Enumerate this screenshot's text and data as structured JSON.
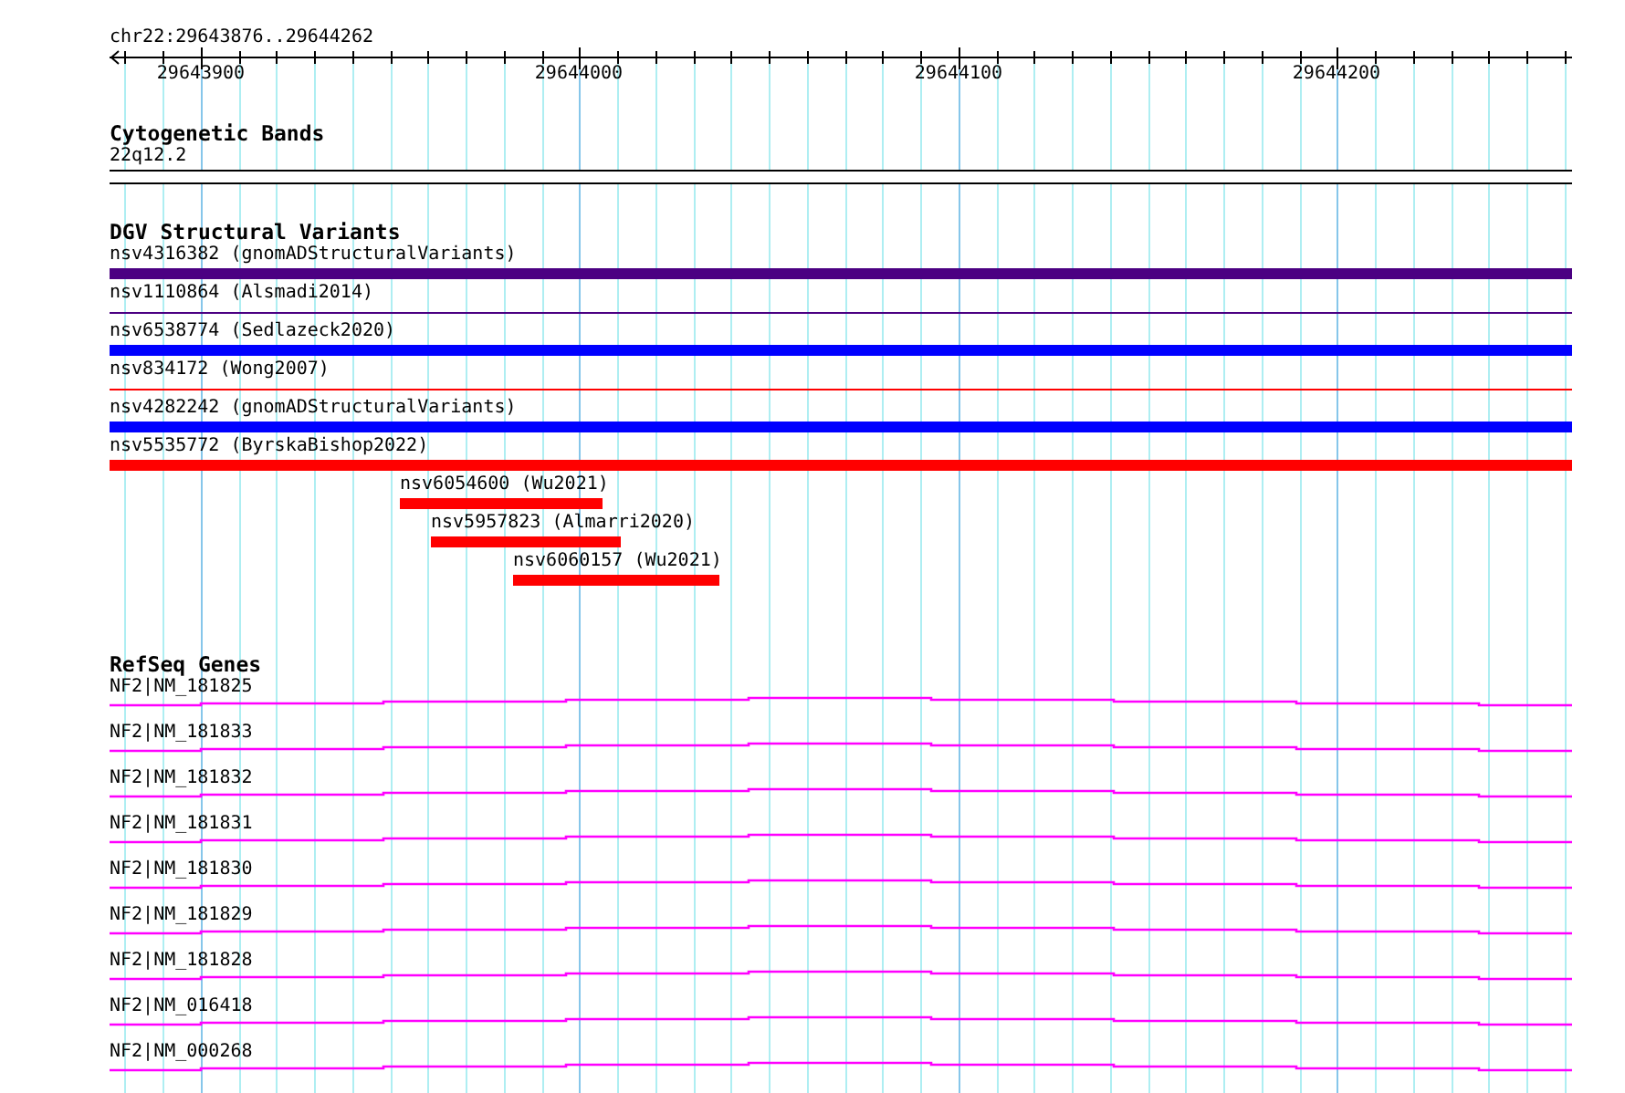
{
  "location": "chr22:29643876..29644262",
  "ruler": {
    "ticks": [
      "29643900",
      "29644000",
      "29644100",
      "29644200"
    ]
  },
  "tracks": [
    {
      "kind": "cytoband",
      "title": "Cytogenetic Bands",
      "band": "22q12.2"
    },
    {
      "kind": "variants",
      "title": "DGV Structural Variants",
      "features": [
        {
          "label": "nsv4316382 (gnomADStructuralVariants)",
          "kind": "bar",
          "color": "#4b0082"
        },
        {
          "label": "nsv1110864 (Alsmadi2014)",
          "kind": "line",
          "color": "#4b0082"
        },
        {
          "label": "nsv6538774 (Sedlazeck2020)",
          "kind": "bar",
          "color": "#0000ff"
        },
        {
          "label": "nsv834172 (Wong2007)",
          "kind": "line",
          "color": "#ff0000"
        },
        {
          "label": "nsv4282242 (gnomADStructuralVariants)",
          "kind": "bar",
          "color": "#0000ff"
        },
        {
          "label": "nsv5535772 (ByrskaBishop2022)",
          "kind": "bar",
          "color": "#ff0000"
        },
        {
          "label": "nsv6054600 (Wu2021)",
          "kind": "bar",
          "color": "#ff0000"
        },
        {
          "label": "nsv5957823 (Almarri2020)",
          "kind": "bar",
          "color": "#ff0000"
        },
        {
          "label": "nsv6060157 (Wu2021)",
          "kind": "bar",
          "color": "#ff0000"
        }
      ]
    },
    {
      "kind": "genes",
      "title": "RefSeq Genes",
      "features": [
        {
          "label": "NF2|NM_181825"
        },
        {
          "label": "NF2|NM_181833"
        },
        {
          "label": "NF2|NM_181832"
        },
        {
          "label": "NF2|NM_181831"
        },
        {
          "label": "NF2|NM_181830"
        },
        {
          "label": "NF2|NM_181829"
        },
        {
          "label": "NF2|NM_181828"
        },
        {
          "label": "NF2|NM_016418"
        },
        {
          "label": "NF2|NM_000268"
        }
      ]
    }
  ]
}
